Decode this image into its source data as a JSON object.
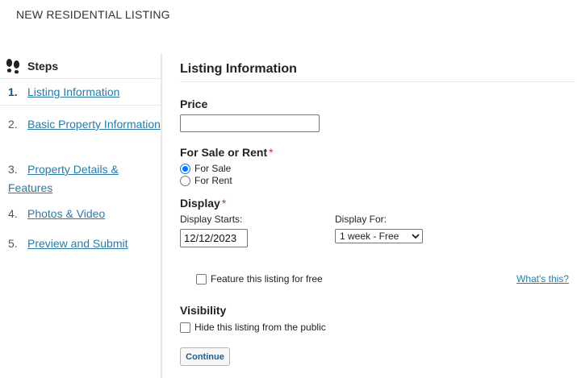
{
  "page": {
    "title": "NEW RESIDENTIAL LISTING"
  },
  "sidebar": {
    "header": "Steps",
    "icon": "footprints-icon",
    "steps": [
      {
        "num": "1.",
        "label": "Listing Information",
        "active": true
      },
      {
        "num": "2.",
        "label": "Basic Property Information"
      },
      {
        "num": "3.",
        "label": "Property Details & Features"
      },
      {
        "num": "4.",
        "label": "Photos & Video"
      },
      {
        "num": "5.",
        "label": "Preview and Submit"
      }
    ]
  },
  "form": {
    "section_title": "Listing Information",
    "price": {
      "label": "Price",
      "value": ""
    },
    "sale_rent": {
      "label": "For Sale or Rent",
      "required": "*",
      "options": [
        "For Sale",
        "For Rent"
      ],
      "selected": "For Sale"
    },
    "display": {
      "label": "Display",
      "required": "*",
      "starts_label": "Display Starts:",
      "starts_value": "12/12/2023",
      "for_label": "Display For:",
      "for_value": "1 week - Free"
    },
    "feature": {
      "label": "Feature this listing for free",
      "checked": false,
      "help_link": "What's this?"
    },
    "visibility": {
      "label": "Visibility",
      "hide_label": "Hide this listing from the public",
      "checked": false
    },
    "continue_label": "Continue"
  },
  "colors": {
    "link": "#2a7aa6",
    "active_step": "#1a4e72",
    "required": "#c0392b",
    "radio_checked": "#0075ff"
  }
}
